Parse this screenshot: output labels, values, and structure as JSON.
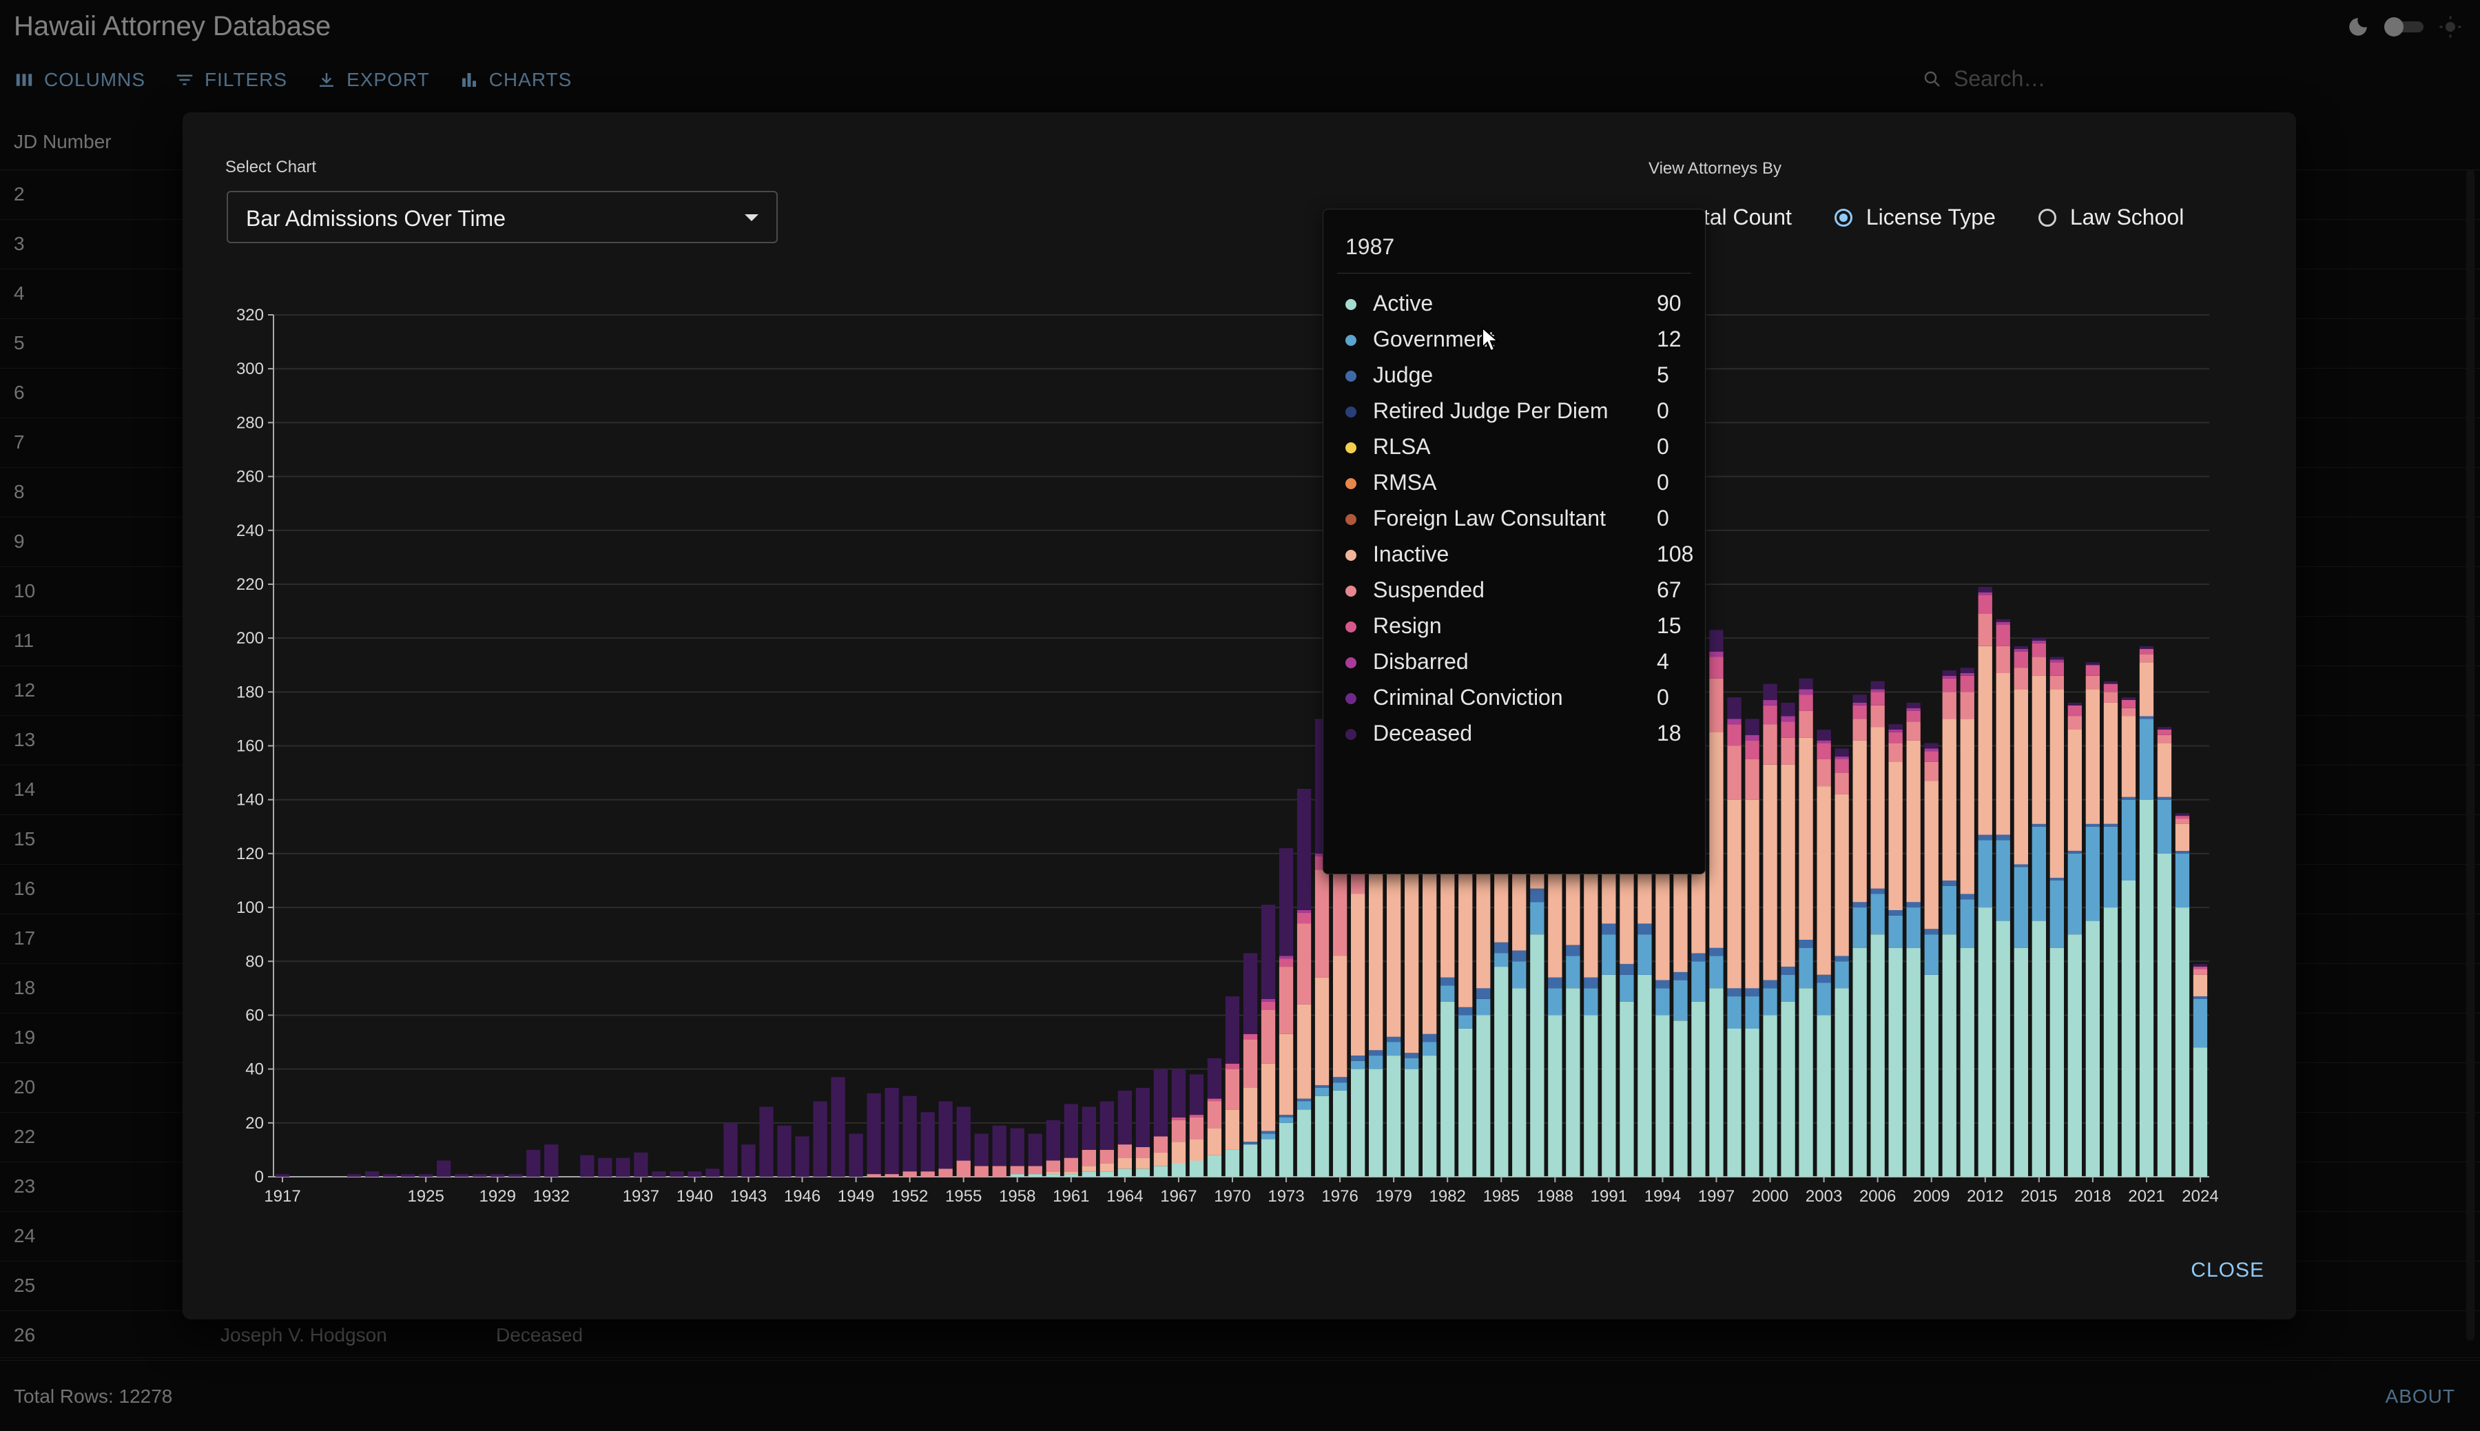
{
  "app": {
    "title": "Hawaii Attorney Database"
  },
  "toolbar": {
    "columns": "COLUMNS",
    "filters": "FILTERS",
    "export": "EXPORT",
    "charts": "CHARTS"
  },
  "search": {
    "placeholder": "Search…"
  },
  "table": {
    "header_first_col": "JD Number",
    "rows": [
      {
        "num": "2"
      },
      {
        "num": "3"
      },
      {
        "num": "4"
      },
      {
        "num": "5"
      },
      {
        "num": "6"
      },
      {
        "num": "7"
      },
      {
        "num": "8"
      },
      {
        "num": "9"
      },
      {
        "num": "10"
      },
      {
        "num": "11"
      },
      {
        "num": "12"
      },
      {
        "num": "13"
      },
      {
        "num": "14"
      },
      {
        "num": "15"
      },
      {
        "num": "16"
      },
      {
        "num": "17"
      },
      {
        "num": "18"
      },
      {
        "num": "19"
      },
      {
        "num": "20"
      },
      {
        "num": "22"
      },
      {
        "num": "23"
      },
      {
        "num": "24"
      },
      {
        "num": "25"
      },
      {
        "num": "26",
        "name": "Joseph V. Hodgson",
        "status": "Deceased"
      }
    ]
  },
  "footer": {
    "total_rows": "Total Rows: 12278",
    "about": "ABOUT"
  },
  "modal": {
    "select_label": "Select Chart",
    "select_value": "Bar Admissions Over Time",
    "view_label": "View Attorneys By",
    "radio_options": [
      {
        "label": "Total Count",
        "selected": false
      },
      {
        "label": "License Type",
        "selected": true
      },
      {
        "label": "Law School",
        "selected": false
      }
    ],
    "close_label": "CLOSE"
  },
  "tooltip": {
    "year": "1987",
    "rows": [
      {
        "name": "Active",
        "value": "90",
        "color": "#a5dbd0"
      },
      {
        "name": "Government",
        "value": "12",
        "color": "#5ba4cf"
      },
      {
        "name": "Judge",
        "value": "5",
        "color": "#3e6aa8"
      },
      {
        "name": "Retired Judge Per Diem",
        "value": "0",
        "color": "#2a3f7a"
      },
      {
        "name": "RLSA",
        "value": "0",
        "color": "#f2d04c"
      },
      {
        "name": "RMSA",
        "value": "0",
        "color": "#e8874a"
      },
      {
        "name": "Foreign Law Consultant",
        "value": "0",
        "color": "#b0583a"
      },
      {
        "name": "Inactive",
        "value": "108",
        "color": "#f2b49a"
      },
      {
        "name": "Suspended",
        "value": "67",
        "color": "#e8868f"
      },
      {
        "name": "Resign",
        "value": "15",
        "color": "#d4588a"
      },
      {
        "name": "Disbarred",
        "value": "4",
        "color": "#a83c98"
      },
      {
        "name": "Criminal Conviction",
        "value": "0",
        "color": "#6e2a8a"
      },
      {
        "name": "Deceased",
        "value": "18",
        "color": "#3d1a55"
      }
    ]
  },
  "chart_data": {
    "type": "bar",
    "stacked": true,
    "ylim": [
      0,
      320
    ],
    "yticks": [
      0,
      20,
      40,
      60,
      80,
      100,
      120,
      140,
      160,
      180,
      200,
      220,
      240,
      260,
      280,
      300,
      320
    ],
    "xtick_labels": [
      "1917",
      "1925",
      "1929",
      "1932",
      "1937",
      "1940",
      "1943",
      "1946",
      "1949",
      "1952",
      "1955",
      "1958",
      "1961",
      "1964",
      "1967",
      "1970",
      "1973",
      "1976",
      "1979",
      "1982",
      "1985",
      "1988",
      "1991",
      "1994",
      "1997",
      "2000",
      "2003",
      "2006",
      "2009",
      "2012",
      "2015",
      "2018",
      "2021",
      "2024"
    ],
    "grid": true,
    "colors": {
      "Active": "#a5dbd0",
      "Government": "#5ba4cf",
      "Judge": "#3e6aa8",
      "Inactive": "#f2b49a",
      "Suspended": "#e8868f",
      "Resign": "#d4588a",
      "Disbarred": "#a83c98",
      "Deceased": "#3d1a55"
    },
    "categories": [
      "1917",
      "1918",
      "1919",
      "1920",
      "1921",
      "1922",
      "1923",
      "1924",
      "1925",
      "1926",
      "1927",
      "1928",
      "1929",
      "1930",
      "1931",
      "1932",
      "1933",
      "1934",
      "1935",
      "1936",
      "1937",
      "1938",
      "1939",
      "1940",
      "1941",
      "1942",
      "1943",
      "1944",
      "1945",
      "1946",
      "1947",
      "1948",
      "1949",
      "1950",
      "1951",
      "1952",
      "1953",
      "1954",
      "1955",
      "1956",
      "1957",
      "1958",
      "1959",
      "1960",
      "1961",
      "1962",
      "1963",
      "1964",
      "1965",
      "1966",
      "1967",
      "1968",
      "1969",
      "1970",
      "1971",
      "1972",
      "1973",
      "1974",
      "1975",
      "1976",
      "1977",
      "1978",
      "1979",
      "1980",
      "1981",
      "1982",
      "1983",
      "1984",
      "1985",
      "1986",
      "1987",
      "1988",
      "1989",
      "1990",
      "1991",
      "1992",
      "1993",
      "1994",
      "1995",
      "1996",
      "1997",
      "1998",
      "1999",
      "2000",
      "2001",
      "2002",
      "2003",
      "2004",
      "2005",
      "2006",
      "2007",
      "2008",
      "2009",
      "2010",
      "2011",
      "2012",
      "2013",
      "2014",
      "2015",
      "2016",
      "2017",
      "2018",
      "2019",
      "2020",
      "2021",
      "2022",
      "2023",
      "2024"
    ],
    "series": [
      {
        "name": "Active",
        "values": [
          0,
          0,
          0,
          0,
          0,
          0,
          0,
          0,
          0,
          0,
          0,
          0,
          0,
          0,
          0,
          0,
          0,
          0,
          0,
          0,
          0,
          0,
          0,
          0,
          0,
          0,
          0,
          0,
          0,
          0,
          0,
          0,
          0,
          0,
          0,
          0,
          0,
          0,
          0,
          0,
          0,
          1,
          1,
          1,
          1,
          2,
          2,
          3,
          3,
          4,
          5,
          6,
          8,
          10,
          12,
          14,
          20,
          25,
          30,
          32,
          40,
          40,
          45,
          40,
          45,
          65,
          55,
          60,
          78,
          70,
          90,
          60,
          70,
          60,
          75,
          65,
          75,
          60,
          58,
          65,
          70,
          55,
          55,
          60,
          65,
          70,
          60,
          70,
          85,
          90,
          85,
          85,
          75,
          90,
          85,
          100,
          95,
          85,
          95,
          85,
          90,
          95,
          100,
          110,
          140,
          120,
          100,
          48
        ]
      },
      {
        "name": "Government",
        "values": [
          0,
          0,
          0,
          0,
          0,
          0,
          0,
          0,
          0,
          0,
          0,
          0,
          0,
          0,
          0,
          0,
          0,
          0,
          0,
          0,
          0,
          0,
          0,
          0,
          0,
          0,
          0,
          0,
          0,
          0,
          0,
          0,
          0,
          0,
          0,
          0,
          0,
          0,
          0,
          0,
          0,
          0,
          0,
          0,
          0,
          0,
          0,
          0,
          0,
          0,
          0,
          0,
          0,
          0,
          0,
          2,
          2,
          3,
          3,
          3,
          3,
          5,
          5,
          4,
          5,
          6,
          5,
          6,
          5,
          10,
          12,
          10,
          12,
          10,
          15,
          10,
          15,
          10,
          15,
          15,
          12,
          12,
          12,
          10,
          10,
          15,
          12,
          10,
          15,
          15,
          12,
          15,
          15,
          18,
          18,
          25,
          30,
          30,
          35,
          25,
          30,
          35,
          30,
          30,
          30,
          20,
          20,
          18
        ]
      },
      {
        "name": "Judge",
        "values": [
          0,
          0,
          0,
          0,
          0,
          0,
          0,
          0,
          0,
          0,
          0,
          0,
          0,
          0,
          0,
          0,
          0,
          0,
          0,
          0,
          0,
          0,
          0,
          0,
          0,
          0,
          0,
          0,
          0,
          0,
          0,
          0,
          0,
          0,
          0,
          0,
          0,
          0,
          0,
          0,
          0,
          0,
          0,
          0,
          0,
          0,
          0,
          0,
          0,
          0,
          0,
          0,
          0,
          0,
          1,
          1,
          1,
          1,
          1,
          2,
          2,
          2,
          2,
          2,
          3,
          3,
          3,
          4,
          4,
          4,
          5,
          4,
          4,
          4,
          4,
          4,
          4,
          3,
          3,
          3,
          3,
          3,
          3,
          3,
          3,
          3,
          3,
          2,
          2,
          2,
          2,
          2,
          2,
          2,
          2,
          2,
          2,
          1,
          1,
          1,
          1,
          1,
          1,
          1,
          1,
          1,
          1,
          1
        ]
      },
      {
        "name": "Inactive",
        "values": [
          0,
          0,
          0,
          0,
          0,
          0,
          0,
          0,
          0,
          0,
          0,
          0,
          0,
          0,
          0,
          0,
          0,
          0,
          0,
          0,
          0,
          0,
          0,
          0,
          0,
          0,
          0,
          0,
          0,
          0,
          0,
          0,
          0,
          0,
          0,
          0,
          0,
          0,
          0,
          0,
          0,
          0,
          0,
          1,
          1,
          2,
          3,
          4,
          4,
          5,
          8,
          8,
          10,
          15,
          20,
          25,
          30,
          35,
          40,
          45,
          60,
          70,
          70,
          75,
          90,
          90,
          70,
          80,
          90,
          100,
          108,
          90,
          90,
          85,
          80,
          75,
          80,
          75,
          70,
          75,
          80,
          70,
          70,
          80,
          75,
          75,
          70,
          60,
          60,
          60,
          55,
          60,
          55,
          60,
          65,
          70,
          60,
          65,
          55,
          70,
          45,
          50,
          45,
          30,
          20,
          20,
          10,
          8
        ]
      },
      {
        "name": "Suspended",
        "values": [
          0,
          0,
          0,
          0,
          0,
          0,
          0,
          0,
          0,
          0,
          0,
          0,
          0,
          0,
          0,
          0,
          0,
          0,
          0,
          0,
          0,
          0,
          0,
          0,
          0,
          0,
          0,
          0,
          0,
          0,
          0,
          0,
          0,
          1,
          1,
          2,
          2,
          3,
          6,
          4,
          4,
          3,
          3,
          4,
          5,
          6,
          5,
          5,
          4,
          6,
          8,
          8,
          10,
          15,
          18,
          20,
          25,
          30,
          40,
          50,
          50,
          40,
          45,
          50,
          50,
          55,
          65,
          55,
          55,
          70,
          67,
          60,
          50,
          45,
          40,
          40,
          30,
          25,
          25,
          20,
          20,
          20,
          15,
          15,
          10,
          10,
          10,
          8,
          8,
          8,
          7,
          7,
          7,
          10,
          10,
          12,
          10,
          8,
          7,
          5,
          5,
          5,
          4,
          3,
          3,
          3,
          2,
          2
        ]
      },
      {
        "name": "Resign",
        "values": [
          0,
          0,
          0,
          0,
          0,
          0,
          0,
          0,
          0,
          0,
          0,
          0,
          0,
          0,
          0,
          0,
          0,
          0,
          0,
          0,
          0,
          0,
          0,
          0,
          0,
          0,
          0,
          0,
          0,
          0,
          0,
          0,
          0,
          0,
          0,
          0,
          0,
          0,
          0,
          0,
          0,
          0,
          0,
          0,
          0,
          0,
          0,
          0,
          0,
          0,
          1,
          1,
          1,
          2,
          2,
          3,
          3,
          4,
          5,
          6,
          7,
          8,
          10,
          10,
          10,
          12,
          12,
          13,
          14,
          15,
          15,
          14,
          13,
          12,
          12,
          10,
          10,
          9,
          9,
          8,
          8,
          8,
          7,
          7,
          6,
          6,
          6,
          5,
          5,
          5,
          4,
          4,
          4,
          5,
          6,
          7,
          8,
          6,
          5,
          5,
          4,
          4,
          3,
          3,
          2,
          2,
          1,
          1
        ]
      },
      {
        "name": "Disbarred",
        "values": [
          0,
          0,
          0,
          0,
          0,
          0,
          0,
          0,
          0,
          0,
          0,
          0,
          0,
          0,
          0,
          0,
          0,
          0,
          0,
          0,
          0,
          0,
          0,
          0,
          0,
          0,
          0,
          0,
          0,
          0,
          0,
          0,
          0,
          0,
          0,
          0,
          0,
          0,
          0,
          0,
          0,
          0,
          0,
          0,
          0,
          0,
          0,
          0,
          0,
          0,
          0,
          0,
          0,
          0,
          0,
          1,
          1,
          1,
          1,
          2,
          2,
          3,
          3,
          3,
          3,
          4,
          4,
          4,
          4,
          4,
          4,
          4,
          3,
          3,
          3,
          3,
          3,
          3,
          2,
          2,
          2,
          2,
          2,
          2,
          2,
          2,
          1,
          1,
          1,
          1,
          1,
          1,
          1,
          1,
          1,
          1,
          1,
          1,
          1,
          1,
          0,
          0,
          0,
          0,
          0,
          0,
          0,
          0
        ]
      },
      {
        "name": "Deceased",
        "values": [
          1,
          0,
          0,
          0,
          1,
          2,
          1,
          1,
          1,
          6,
          1,
          1,
          1,
          1,
          10,
          12,
          0,
          8,
          7,
          7,
          9,
          2,
          2,
          2,
          3,
          20,
          12,
          26,
          19,
          15,
          28,
          37,
          16,
          30,
          32,
          28,
          22,
          25,
          20,
          12,
          15,
          14,
          12,
          15,
          20,
          16,
          18,
          20,
          22,
          25,
          18,
          15,
          15,
          25,
          30,
          35,
          40,
          45,
          50,
          70,
          60,
          75,
          80,
          70,
          70,
          75,
          70,
          60,
          60,
          55,
          45,
          40,
          35,
          30,
          25,
          20,
          18,
          15,
          12,
          10,
          8,
          8,
          6,
          6,
          5,
          4,
          4,
          3,
          3,
          3,
          2,
          2,
          2,
          2,
          2,
          2,
          1,
          1,
          1,
          1,
          1,
          1,
          1,
          1,
          1,
          1,
          1,
          1
        ]
      }
    ]
  }
}
